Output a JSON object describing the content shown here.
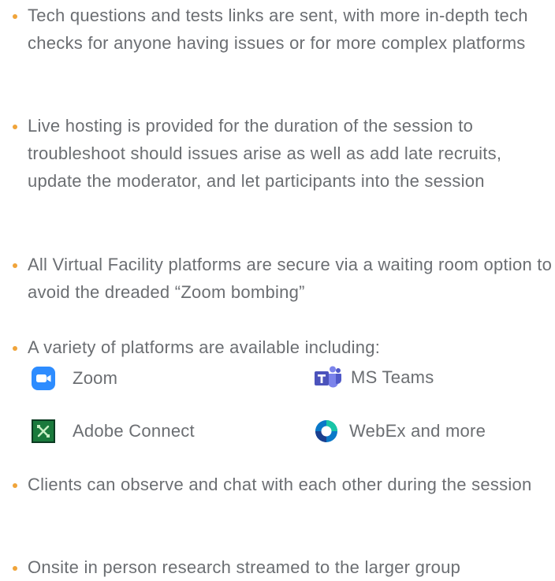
{
  "bullets": [
    {
      "text": "Tech questions and tests links are sent, with more in-depth tech checks for anyone having issues or for more complex platforms"
    },
    {
      "text": "Live hosting is provided for the duration of the session to troubleshoot should issues arise as well as add late recruits, update the moderator, and let participants into the session"
    },
    {
      "text": "All Virtual Facility platforms are secure via a waiting room option to avoid the dreaded “Zoom bombing”"
    },
    {
      "text": "A variety of platforms are available including:"
    },
    {
      "text": "Clients can observe and chat with each other during the session"
    },
    {
      "text": "Onsite in person research streamed to the larger group"
    }
  ],
  "platforms": [
    {
      "label": "Zoom",
      "icon": "zoom-icon"
    },
    {
      "label": "MS Teams",
      "icon": "ms-teams-icon"
    },
    {
      "label": "Adobe Connect",
      "icon": "adobe-connect-icon"
    },
    {
      "label": "WebEx and more",
      "icon": "webex-icon"
    }
  ],
  "colors": {
    "text": "#6b6e72",
    "bullet": "#f0a43a",
    "zoom_blue": "#2d8cff",
    "teams_purple": "#5059c9",
    "adobe_green": "#1a7a3c",
    "webex_blue": "#0a78c8"
  }
}
